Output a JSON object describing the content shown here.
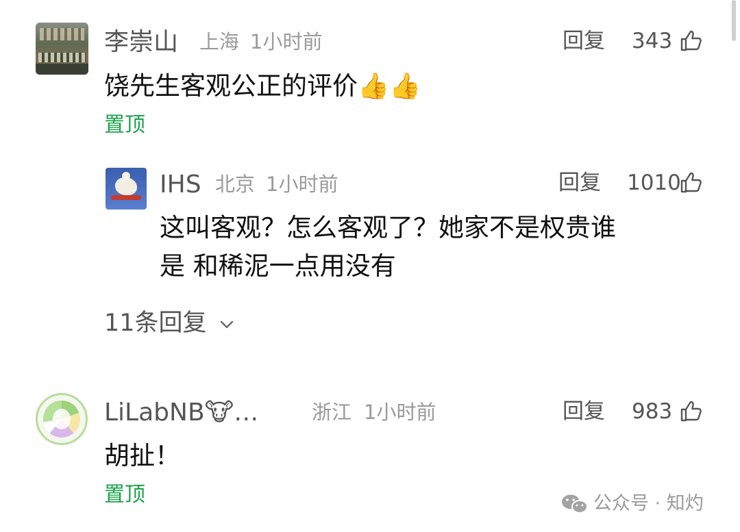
{
  "comments": [
    {
      "username": "李崇山",
      "location": "上海",
      "time": "1小时前",
      "reply_label": "回复",
      "likes": "343",
      "text": "饶先生客观公正的评价👍👍",
      "pin_label": "置顶"
    },
    {
      "username": "LiLabNB🐮…",
      "location": "浙江",
      "time": "1小时前",
      "reply_label": "回复",
      "likes": "983",
      "text": "胡扯！",
      "pin_label": "置顶"
    }
  ],
  "reply": {
    "username": "IHS",
    "location": "北京",
    "time": "1小时前",
    "reply_label": "回复",
    "likes": "1010",
    "text_line1": "这叫客观？怎么客观了？她家不是权贵谁",
    "text_line2": "是 和稀泥一点用没有"
  },
  "thread": {
    "more_replies": "11条回复"
  },
  "watermark": {
    "text": "公众号 · 知灼"
  },
  "colors": {
    "pin_green": "#1aa34a",
    "meta_gray": "#9a9a9a"
  }
}
